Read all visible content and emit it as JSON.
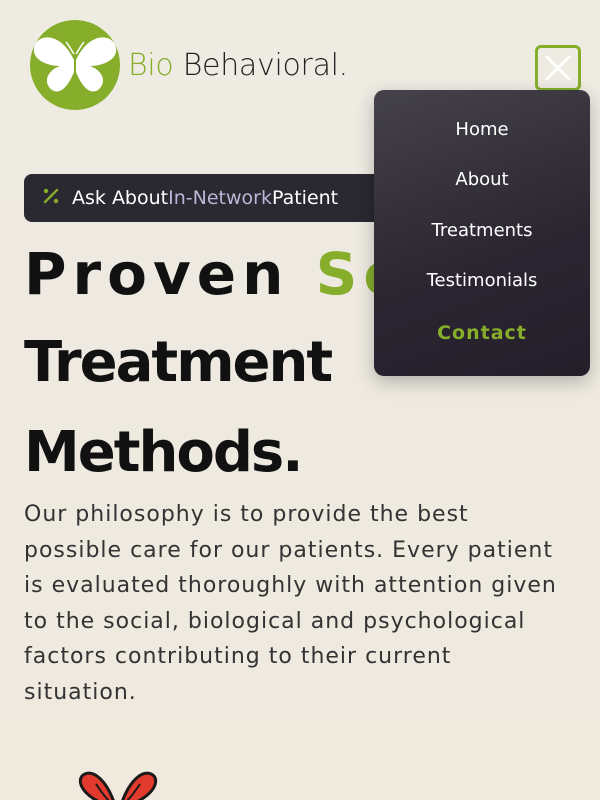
{
  "brand": {
    "name_part1": "Bio",
    "name_part2": "Behavioral.",
    "accent_color": "#86ae2b",
    "icon": "butterfly-logo-icon"
  },
  "header": {
    "close_icon": "close-icon"
  },
  "banner": {
    "icon": "percent-icon",
    "text_before": "Ask About ",
    "text_highlight": "In-Network",
    "text_after": " Patient"
  },
  "hero": {
    "line1_word1": "Proven",
    "line1_word2": "Sci",
    "line2": "Treatment",
    "line3": "Methods.",
    "paragraph": "Our philosophy is to provide the best possible care for our patients. Every patient is evaluated thoroughly with attention given to the social, biological and psychological factors contributing to their current situation."
  },
  "menu": {
    "items": [
      {
        "label": "Home"
      },
      {
        "label": "About"
      },
      {
        "label": "Treatments"
      },
      {
        "label": "Testimonials"
      },
      {
        "label": "Contact"
      }
    ]
  }
}
